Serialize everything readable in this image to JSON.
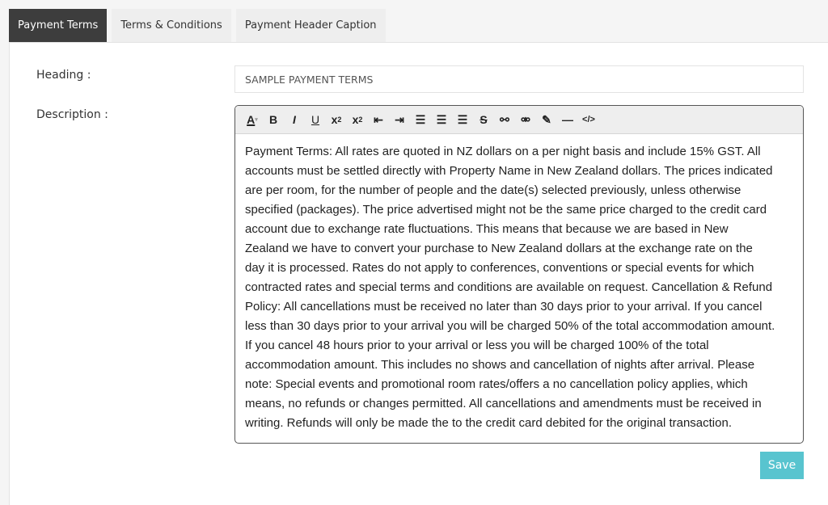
{
  "tabs": [
    {
      "label": "Payment Terms",
      "active": true
    },
    {
      "label": "Terms & Conditions"
    },
    {
      "label": "Payment Header Caption"
    }
  ],
  "form": {
    "heading_label": "Heading :",
    "heading_value": "SAMPLE PAYMENT TERMS",
    "description_label": "Description :",
    "toolbar": [
      "font-color-icon",
      "bold-icon",
      "italic-icon",
      "underline-icon",
      "subscript-icon",
      "superscript-icon",
      "outdent-icon",
      "indent-icon",
      "align-left-icon",
      "align-center-icon",
      "align-right-icon",
      "strikethrough-icon",
      "link-icon",
      "unlink-icon",
      "eraser-icon",
      "horizontal-rule-icon",
      "source-code-icon"
    ],
    "description_lines": [
      "Payment Terms: All rates are quoted in NZ dollars on a per night basis and include 15% GST. All",
      "accounts must be settled directly with Property Name in New Zealand dollars. The prices indicated",
      "are per room, for the number of people and the date(s) selected previously, unless otherwise",
      "specified (packages). The price advertised might not be the same price charged to the credit card",
      "account due to exchange rate fluctuations. This means that because we are based in New",
      "Zealand we have to convert your purchase to New Zealand dollars at the exchange rate on the",
      "day it is processed. Rates do not apply to conferences, conventions or special events for which",
      "contracted rates and special terms and conditions are available on request. Cancellation & Refund",
      "Policy: All cancellations must be received no later than 30 days prior to your arrival. If you cancel",
      "less than 30 days prior to your arrival you will be charged 50% of the total accommodation amount.",
      "If you cancel 48 hours prior to your arrival or less you will be charged 100% of the total",
      "accommodation amount. This includes no shows and cancellation of nights after arrival. Please",
      "note: Special events and promotional room rates/offers a no cancellation policy applies, which",
      "means, no refunds or changes permitted. All cancellations and amendments must be received in",
      "writing. Refunds will only be made the to the credit card debited for the original transaction."
    ],
    "save_label": "Save"
  },
  "colors": {
    "active_tab": "#3d3d3d",
    "save_button": "#58c4cf"
  }
}
